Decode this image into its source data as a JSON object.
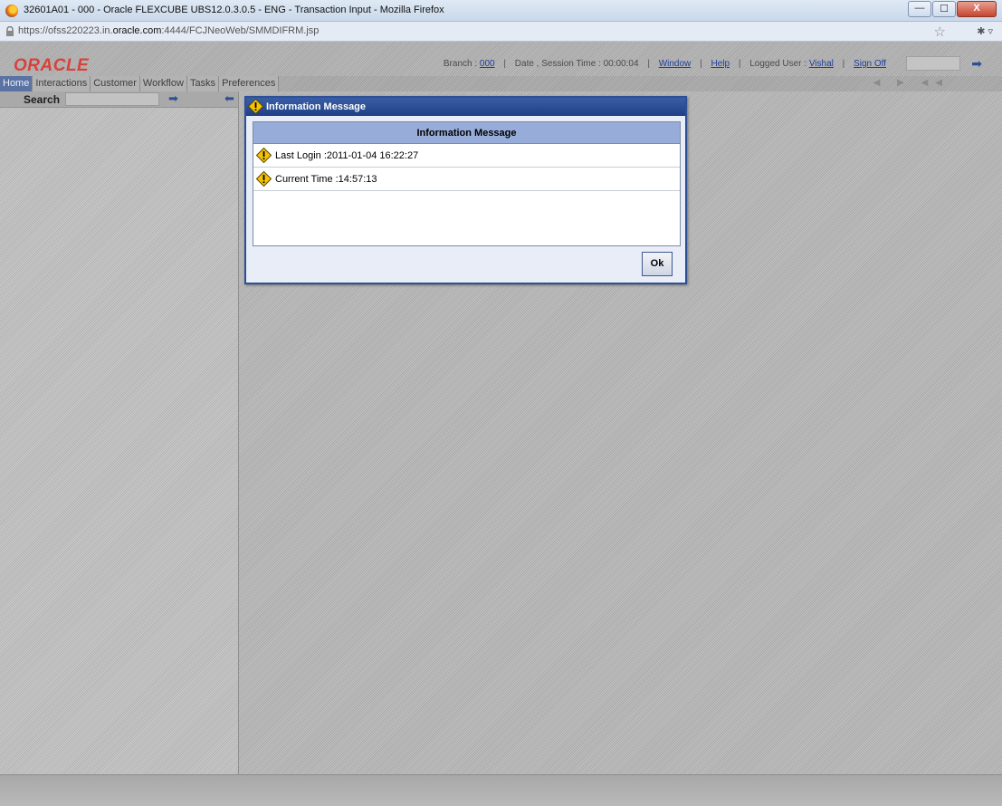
{
  "browser": {
    "window_title": "32601A01 - 000 - Oracle FLEXCUBE UBS12.0.3.0.5 - ENG - Transaction Input - Mozilla Firefox",
    "url_prefix": "https://ofss220223.in.",
    "url_host": "oracle.com",
    "url_suffix": ":4444/FCJNeoWeb/SMMDIFRM.jsp",
    "window_buttons": {
      "minimize": "—",
      "maximize": "☐",
      "close": "X"
    }
  },
  "header": {
    "logo": "ORACLE",
    "branch_label": "Branch :",
    "branch_value": "000",
    "session_label": "Date , Session Time : 00:00:04",
    "window_link": "Window",
    "help_link": "Help",
    "logged_user_label": "Logged User :",
    "logged_user_value": "Vishal",
    "signoff_link": "Sign Off"
  },
  "menu": {
    "items": [
      {
        "label": "Home",
        "active": true
      },
      {
        "label": "Interactions"
      },
      {
        "label": "Customer"
      },
      {
        "label": "Workflow"
      },
      {
        "label": "Tasks"
      },
      {
        "label": "Preferences"
      }
    ]
  },
  "sidebar": {
    "search_label": "Search"
  },
  "dialog": {
    "title": "Information Message",
    "header": "Information Message",
    "messages": [
      {
        "text": "Last Login :2011-01-04 16:22:27",
        "icon": "warning-icon"
      },
      {
        "text": "Current Time :14:57:13",
        "icon": "warning-icon"
      }
    ],
    "ok_label": "Ok"
  },
  "colors": {
    "accent": "#2d4f96",
    "dialog_title": "#1e3f85",
    "grid_header": "#97acd9",
    "warning": "#f5c400",
    "oracle_red": "#d8423c"
  }
}
